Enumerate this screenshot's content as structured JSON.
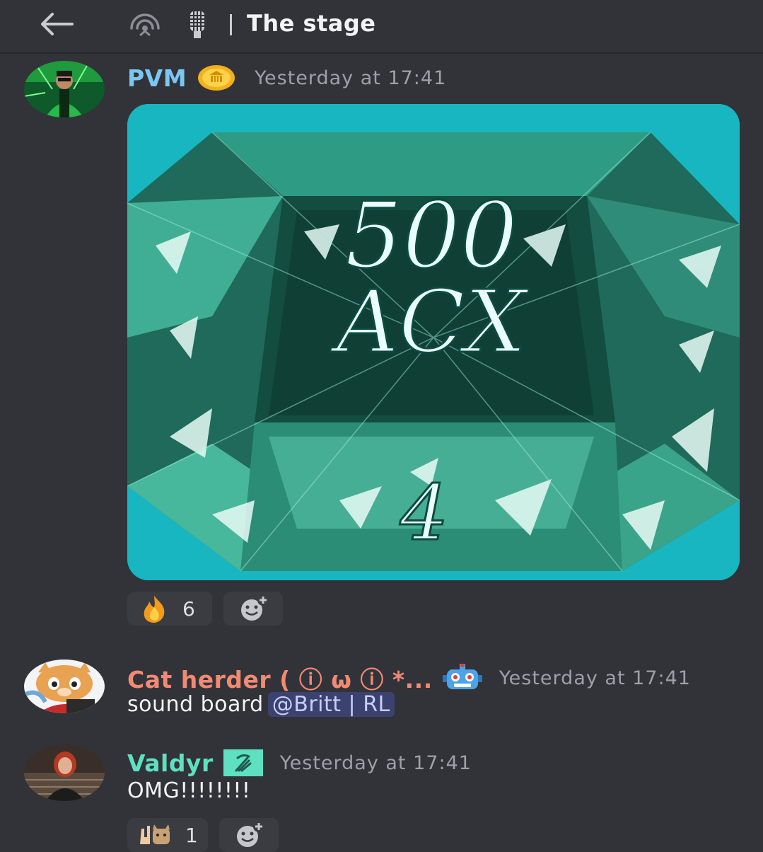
{
  "header": {
    "title": "The stage",
    "back_icon": "arrow-left-icon",
    "stage_icon": "stage-channel-icon",
    "mic_icon": "microphone-icon"
  },
  "messages": [
    {
      "username": "PVM",
      "username_color": "#7cc6f2",
      "badge_icon": "gold-coin-badge",
      "timestamp": "Yesterday at 17:41",
      "image": {
        "line1": "500",
        "line2": "ACX",
        "line3": "4"
      },
      "reactions": [
        {
          "emoji": "fire",
          "count": "6"
        }
      ]
    },
    {
      "username": "Cat herder ( ⓘ ω ⓘ *...",
      "username_color": "#f08a74",
      "badge_icon": "robot-emoji",
      "timestamp": "Yesterday at 17:41",
      "text": "sound board",
      "mention": "@Britt | RL"
    },
    {
      "username": "Valdyr",
      "username_color": "#5fe0c0",
      "badge_icon": "signal-badge",
      "timestamp": "Yesterday at 17:41",
      "text": "OMG!!!!!!!!",
      "reactions": [
        {
          "emoji": "rock-hand-cat",
          "count": "1"
        }
      ]
    }
  ],
  "colors": {
    "background": "#313338",
    "accent_teal": "#1bb9c4",
    "mention_bg": "#3c4270"
  }
}
